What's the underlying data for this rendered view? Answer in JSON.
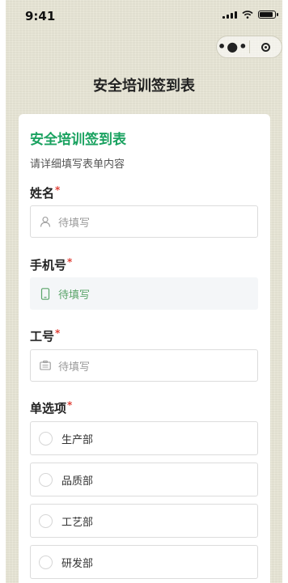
{
  "status_bar": {
    "time": "9:41"
  },
  "nav": {
    "title": "安全培训签到表",
    "more_glyph": "•●•"
  },
  "form": {
    "title": "安全培训签到表",
    "subtitle": "请详细填写表单内容",
    "required_mark": "*",
    "fields": [
      {
        "label": "姓名",
        "placeholder": "待填写",
        "icon": "person-icon"
      },
      {
        "label": "手机号",
        "placeholder": "待填写",
        "icon": "phone-icon"
      },
      {
        "label": "工号",
        "placeholder": "待填写",
        "icon": "id-card-icon"
      }
    ],
    "choice": {
      "label": "单选项",
      "options": [
        "生产部",
        "品质部",
        "工艺部",
        "研发部"
      ]
    }
  },
  "colors": {
    "accent": "#1aa260",
    "required": "#e0433a",
    "background": "#e9e7d7"
  }
}
